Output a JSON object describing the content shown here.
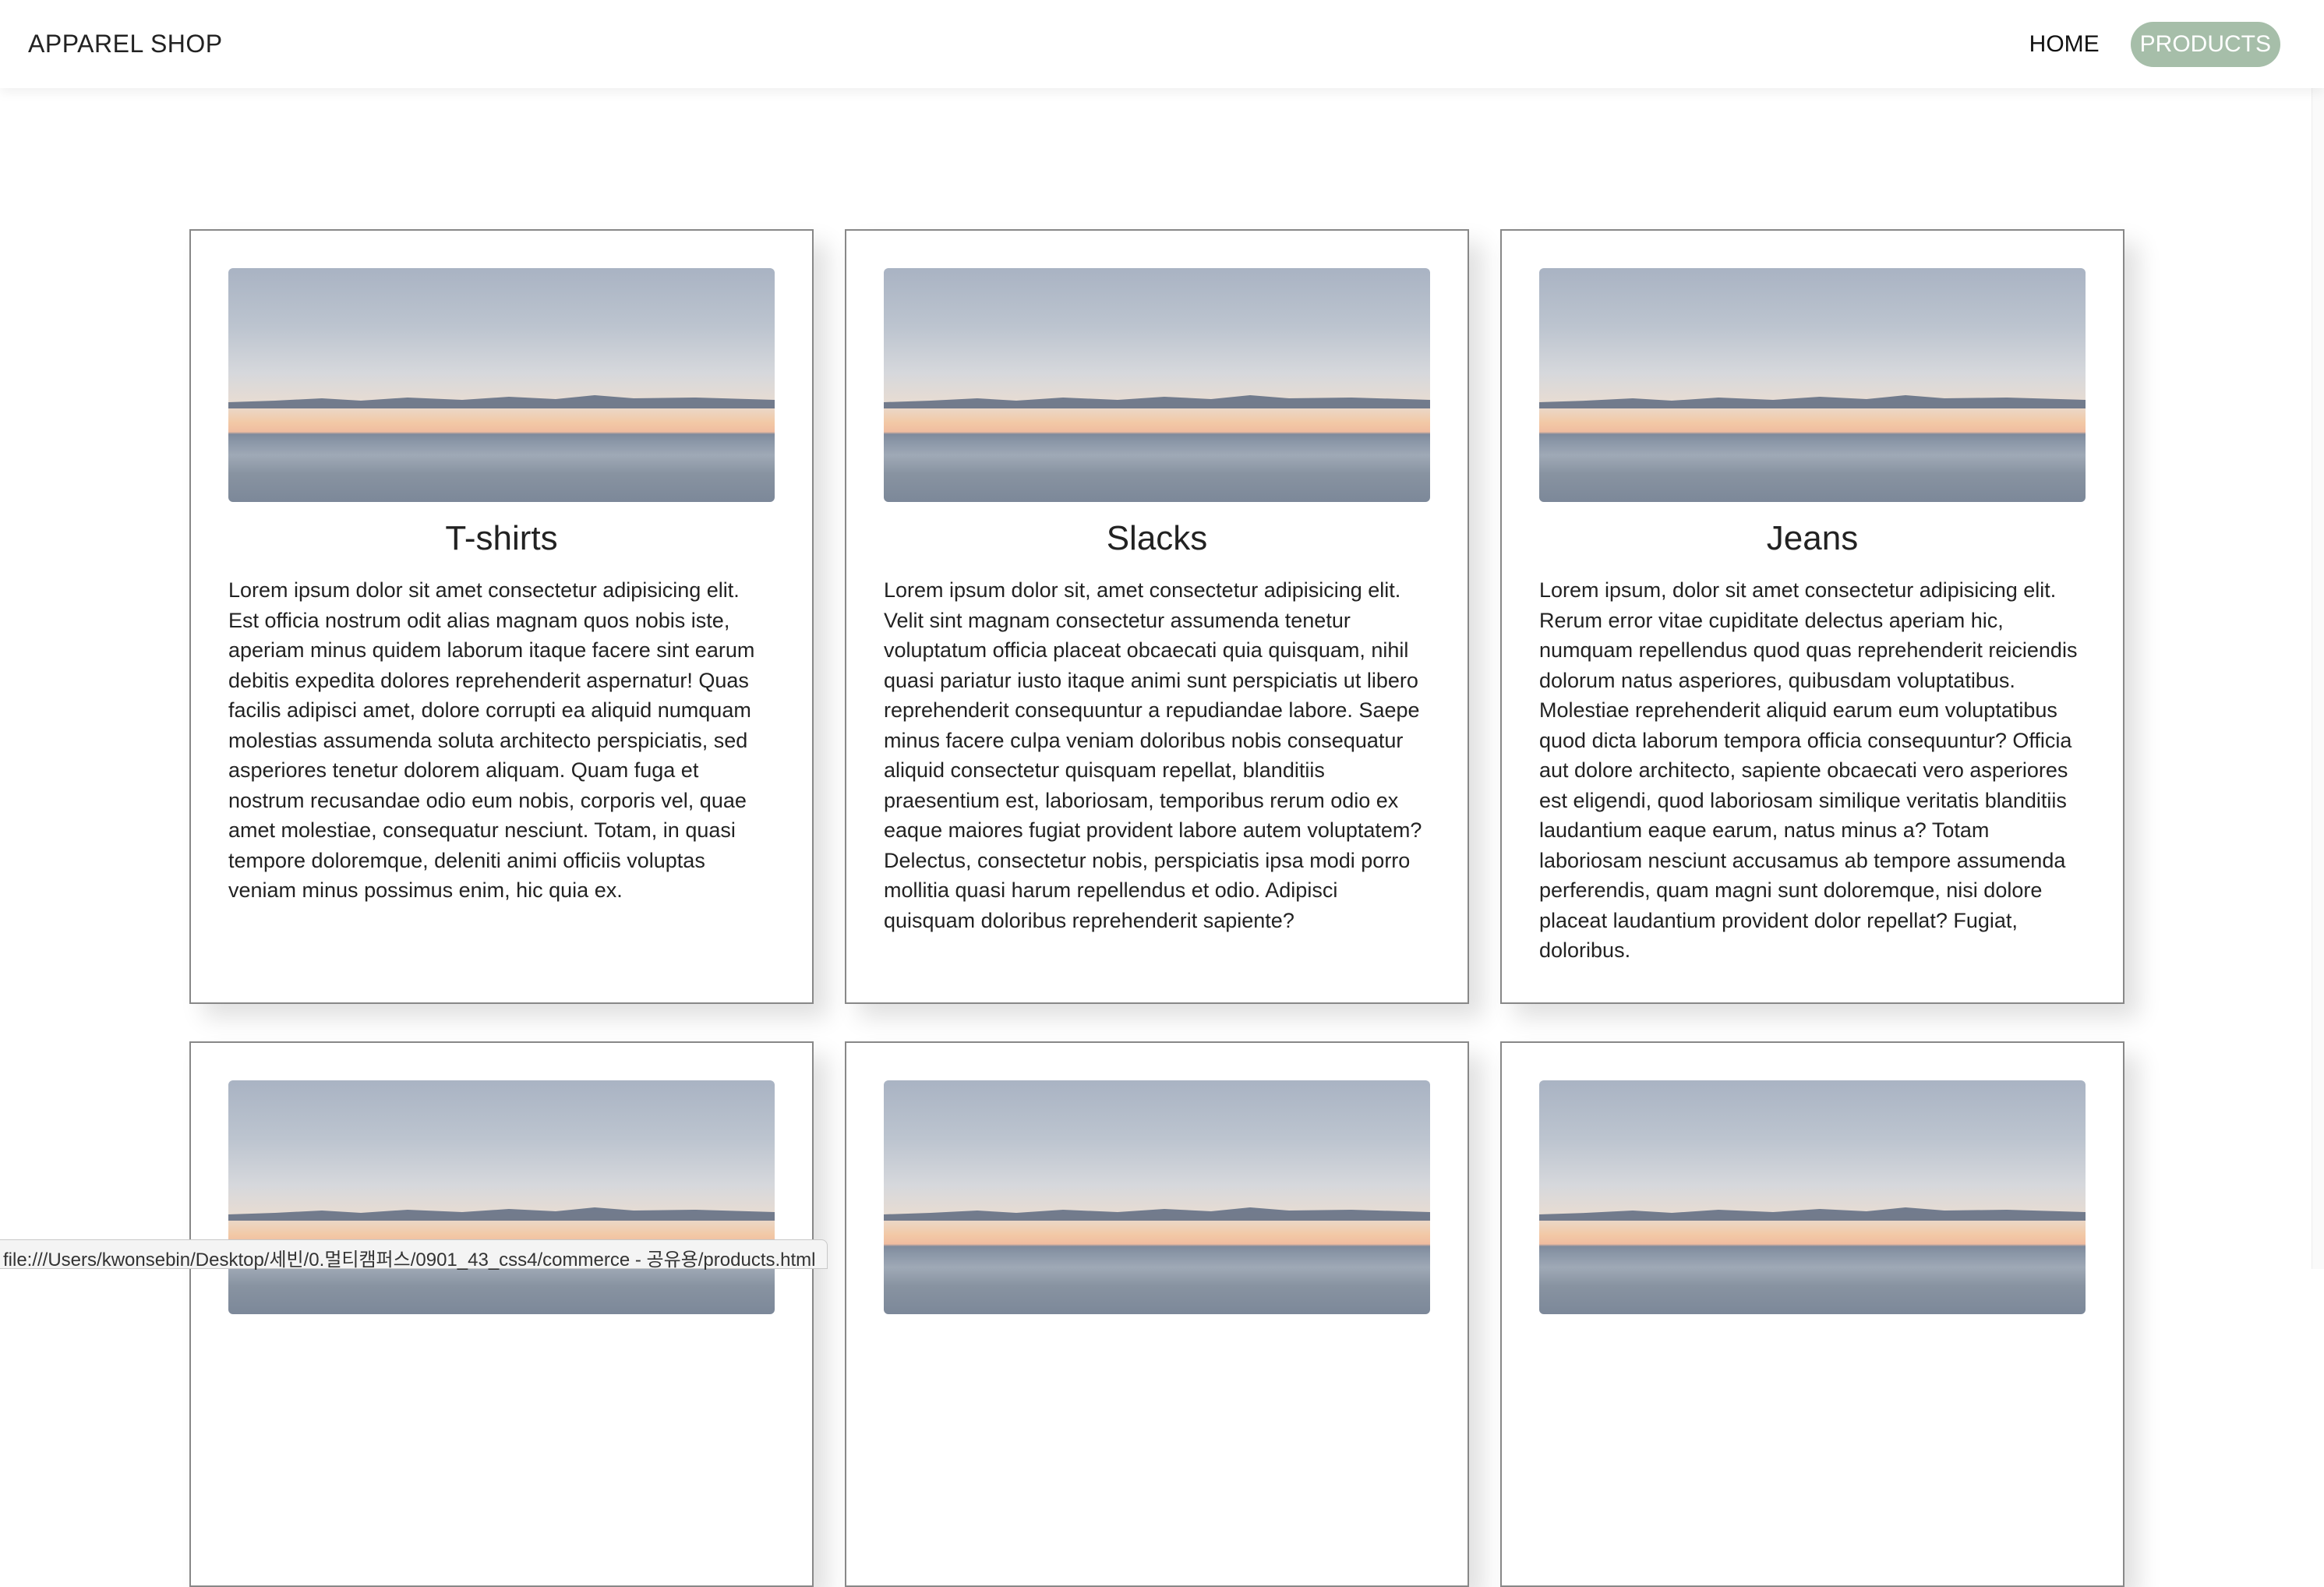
{
  "nav": {
    "brand": "APPAREL SHOP",
    "links": [
      {
        "label": "HOME",
        "active": false
      },
      {
        "label": "PRODUCTS",
        "active": true
      }
    ]
  },
  "products": [
    {
      "title": "T-shirts",
      "description": "Lorem ipsum dolor sit amet consectetur adipisicing elit. Est officia nostrum odit alias magnam quos nobis iste, aperiam minus quidem laborum itaque facere sint earum debitis expedita dolores reprehenderit aspernatur! Quas facilis adipisci amet, dolore corrupti ea aliquid numquam molestias assumenda soluta architecto perspiciatis, sed asperiores tenetur dolorem aliquam. Quam fuga et nostrum recusandae odio eum nobis, corporis vel, quae amet molestiae, consequatur nesciunt. Totam, in quasi tempore doloremque, deleniti animi officiis voluptas veniam minus possimus enim, hic quia ex."
    },
    {
      "title": "Slacks",
      "description": "Lorem ipsum dolor sit, amet consectetur adipisicing elit. Velit sint magnam consectetur assumenda tenetur voluptatum officia placeat obcaecati quia quisquam, nihil quasi pariatur iusto itaque animi sunt perspiciatis ut libero reprehenderit consequuntur a repudiandae labore. Saepe minus facere culpa veniam doloribus nobis consequatur aliquid consectetur quisquam repellat, blanditiis praesentium est, laboriosam, temporibus rerum odio ex eaque maiores fugiat provident labore autem voluptatem? Delectus, consectetur nobis, perspiciatis ipsa modi porro mollitia quasi harum repellendus et odio. Adipisci quisquam doloribus reprehenderit sapiente?"
    },
    {
      "title": "Jeans",
      "description": "Lorem ipsum, dolor sit amet consectetur adipisicing elit. Rerum error vitae cupiditate delectus aperiam hic, numquam repellendus quod quas reprehenderit reiciendis dolorum natus asperiores, quibusdam voluptatibus. Molestiae reprehenderit aliquid earum eum voluptatibus quod dicta laborum tempora officia consequuntur? Officia aut dolore architecto, sapiente obcaecati vero asperiores est eligendi, quod laboriosam similique veritatis blanditiis laudantium eaque earum, natus minus a? Totam laboriosam nesciunt accusamus ab tempore assumenda perferendis, quam magni sunt doloremque, nisi dolore placeat laudantium provident dolor repellat? Fugiat, doloribus."
    }
  ],
  "status_bar": {
    "url": "file:///Users/kwonsebin/Desktop/세빈/0.멀티캠퍼스/0901_43_css4/commerce - 공유용/products.html"
  },
  "colors": {
    "active_nav_bg": "#a6bea9",
    "card_border": "#888888"
  }
}
